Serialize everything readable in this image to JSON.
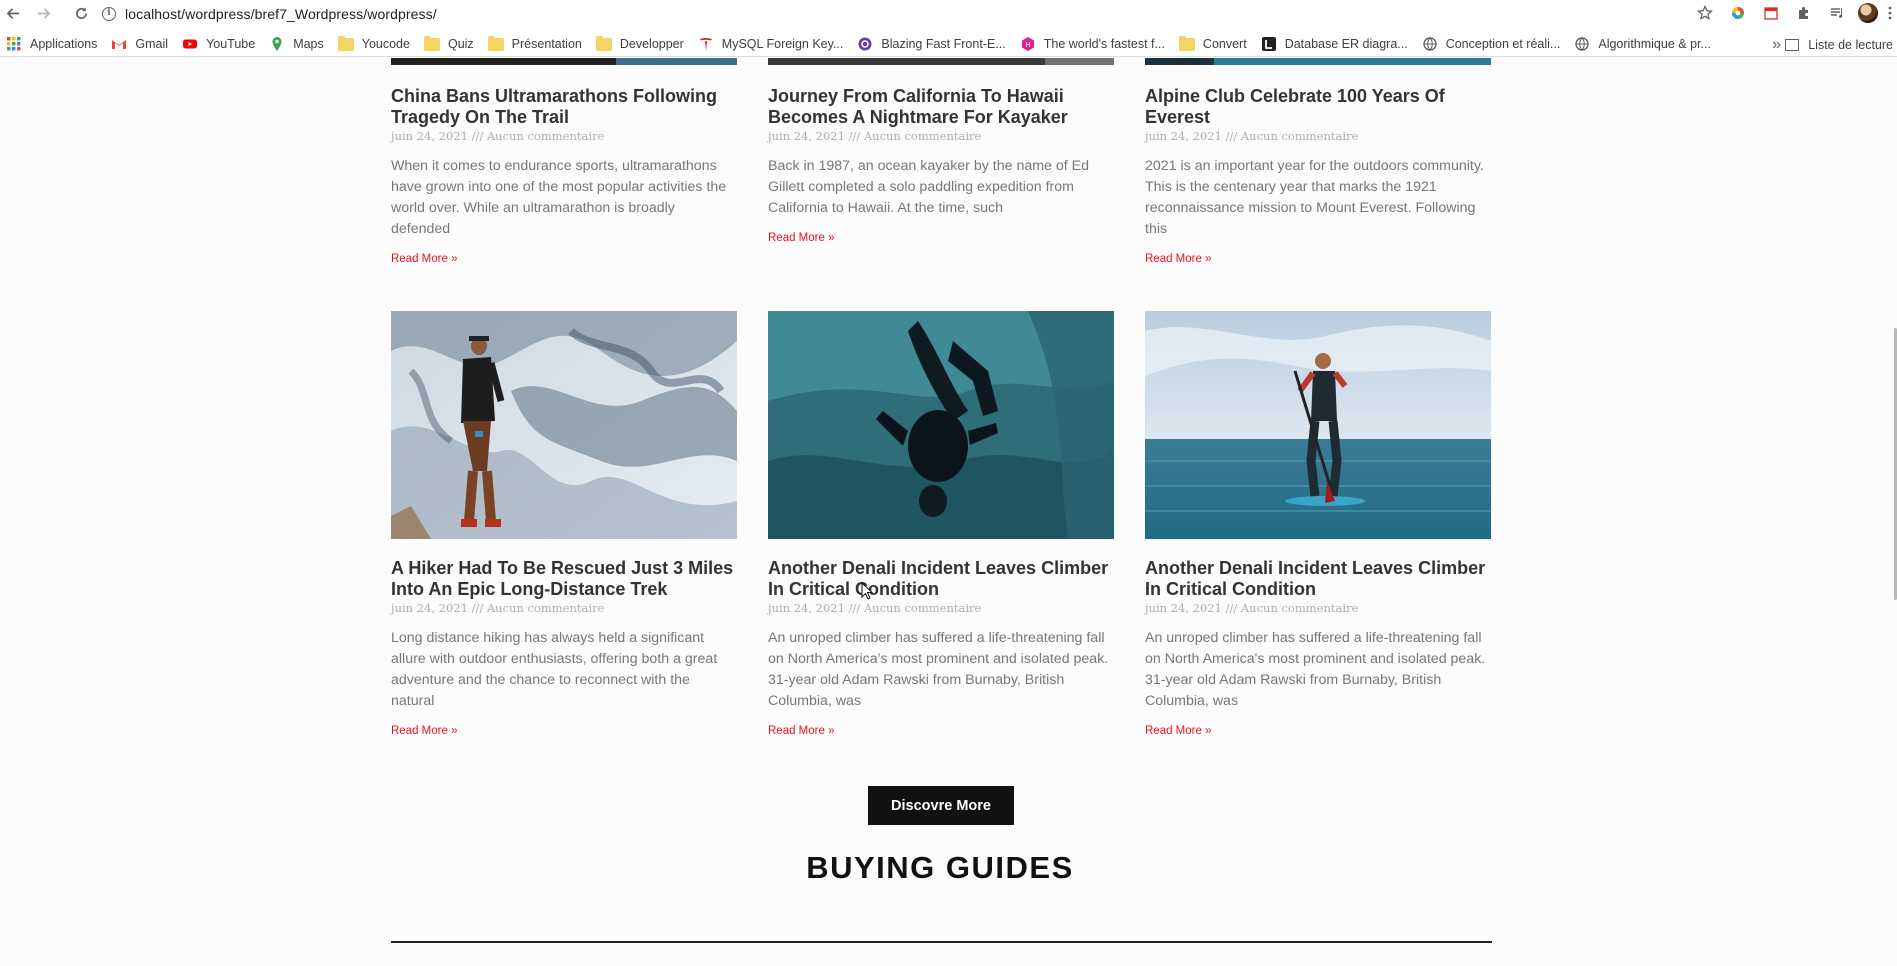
{
  "browser": {
    "url": "localhost/wordpress/bref7_Wordpress/wordpress/",
    "bookmarks": [
      {
        "label": "Applications",
        "icon": "apps-grid-icon",
        "color": "#4285f4"
      },
      {
        "label": "Gmail",
        "icon": "gmail-icon",
        "color": "#ea4335"
      },
      {
        "label": "YouTube",
        "icon": "youtube-icon",
        "color": "#ff0000"
      },
      {
        "label": "Maps",
        "icon": "maps-icon",
        "color": "#34a853"
      },
      {
        "label": "Youcode",
        "icon": "folder-icon",
        "color": "#f6d365"
      },
      {
        "label": "Quiz",
        "icon": "folder-icon",
        "color": "#f6d365"
      },
      {
        "label": "Présentation",
        "icon": "folder-icon",
        "color": "#f6d365"
      },
      {
        "label": "Developper",
        "icon": "folder-icon",
        "color": "#f6d365"
      },
      {
        "label": "MySQL Foreign Key...",
        "icon": "tesla-icon",
        "color": "#e82127"
      },
      {
        "label": "Blazing Fast Front-E...",
        "icon": "circle-logo-icon",
        "color": "#6b3fa0"
      },
      {
        "label": "The world's fastest f...",
        "icon": "hexagon-logo-icon",
        "color": "#e0218a"
      },
      {
        "label": "Convert",
        "icon": "folder-icon",
        "color": "#f6d365"
      },
      {
        "label": "Database ER diagra...",
        "icon": "lucid-icon",
        "color": "#222222"
      },
      {
        "label": "Conception et réali...",
        "icon": "globe-icon",
        "color": "#5f6368"
      },
      {
        "label": "Algorithmique & pr...",
        "icon": "globe-icon",
        "color": "#5f6368"
      }
    ],
    "more_bookmarks": "»",
    "reading_list": "Liste de lecture"
  },
  "posts_row1": [
    {
      "title": "China Bans Ultramarathons Following Tragedy On The Trail",
      "meta": "juin 24, 2021 /// Aucun commentaire",
      "excerpt": "When it comes to endurance sports, ultramarathons have grown into one of the most popular activities the world over. While an ultramarathon is broadly defended",
      "read_more": "Read More »"
    },
    {
      "title": "Journey From California To Hawaii Becomes A Nightmare For Kayaker",
      "meta": "juin 24, 2021 /// Aucun commentaire",
      "excerpt": "Back in 1987, an ocean kayaker by the name of Ed Gillett completed a solo paddling expedition from California to Hawaii. At the time, such",
      "read_more": "Read More »"
    },
    {
      "title": "Alpine Club Celebrate 100 Years Of Everest",
      "meta": "juin 24, 2021 /// Aucun commentaire",
      "excerpt": "2021 is an important year for the outdoors community. This is the centenary year that marks the 1921 reconnaissance mission to Mount Everest. Following this",
      "read_more": "Read More »"
    }
  ],
  "posts_row2": [
    {
      "title": "A Hiker Had To Be Rescued Just 3 Miles Into An Epic Long-Distance Trek",
      "meta": "juin 24, 2021 /// Aucun commentaire",
      "excerpt": "Long distance hiking has always held a significant allure with outdoor enthusiasts, offering both a great adventure and the chance to reconnect with the natural",
      "read_more": "Read More »"
    },
    {
      "title": "Another Denali Incident Leaves Climber In Critical Condition",
      "meta": "juin 24, 2021 /// Aucun commentaire",
      "excerpt": "An unroped climber has suffered a life-threatening fall on North America's most prominent and isolated peak. 31-year old Adam Rawski from Burnaby, British Columbia, was",
      "read_more": "Read More »"
    },
    {
      "title": "Another Denali Incident Leaves Climber In Critical Condition",
      "meta": "juin 24, 2021 /// Aucun commentaire",
      "excerpt": "An unroped climber has suffered a life-threatening fall on North America's most prominent and isolated peak. 31-year old Adam Rawski from Burnaby, British Columbia, was",
      "read_more": "Read More »"
    }
  ],
  "discover_button": "Discovre More",
  "buying_guides_title": "BUYING GUIDES",
  "colors": {
    "read_more": "#e6141c",
    "button_bg": "#111111",
    "title": "#333333",
    "meta": "#adadad",
    "excerpt": "#777777"
  }
}
